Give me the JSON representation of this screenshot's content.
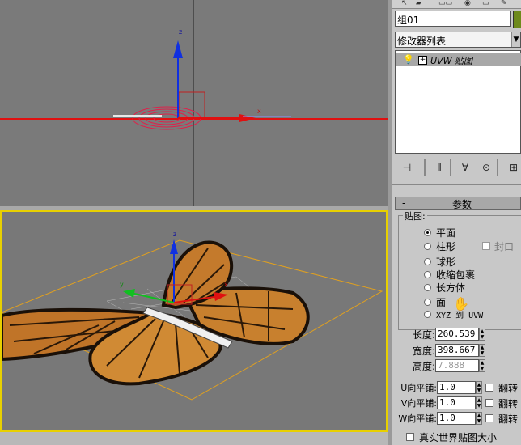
{
  "viewports": {
    "top": {
      "axis_x": "x",
      "axis_z": "z"
    },
    "perspective": {
      "axis_z": "z",
      "axis_x": "x",
      "axis_y": "y"
    }
  },
  "panel": {
    "object_name": "组01",
    "object_color": "#6e8a1c",
    "modifier_list": "修改器列表",
    "stack": [
      {
        "label": "UVW 贴图",
        "expand": "+"
      }
    ],
    "rollout_toggle": "-",
    "rollout_title": "参数",
    "mapping_group": "贴图:",
    "mapping_types": [
      {
        "label": "平面",
        "checked": true
      },
      {
        "label": "柱形",
        "checked": false
      },
      {
        "label": "球形",
        "checked": false
      },
      {
        "label": "收缩包裹",
        "checked": false
      },
      {
        "label": "长方体",
        "checked": false
      },
      {
        "label": "面",
        "checked": false
      },
      {
        "label": "XYZ 到 UVW",
        "checked": false
      }
    ],
    "cap_label": "封口",
    "length_label": "长度:",
    "length_value": "260.539",
    "width_label": "宽度:",
    "width_value": "398.667",
    "height_label": "高度:",
    "height_value": "7.888",
    "tiles": [
      {
        "label": "U向平铺:",
        "value": "1.0",
        "flip": "翻转"
      },
      {
        "label": "V向平铺:",
        "value": "1.0",
        "flip": "翻转"
      },
      {
        "label": "W向平铺:",
        "value": "1.0",
        "flip": "翻转"
      }
    ],
    "real_world": "真实世界贴图大小"
  }
}
